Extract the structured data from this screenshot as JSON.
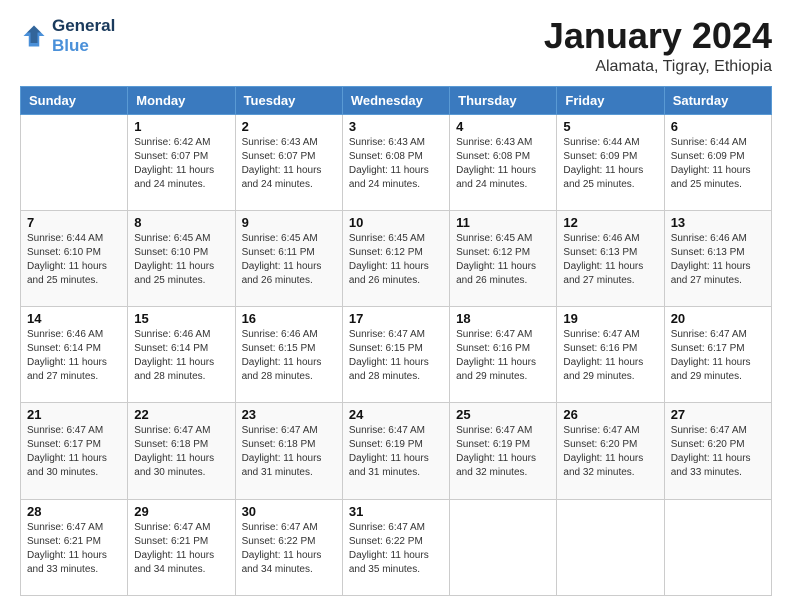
{
  "header": {
    "logo_line1": "General",
    "logo_line2": "Blue",
    "title": "January 2024",
    "subtitle": "Alamata, Tigray, Ethiopia"
  },
  "weekdays": [
    "Sunday",
    "Monday",
    "Tuesday",
    "Wednesday",
    "Thursday",
    "Friday",
    "Saturday"
  ],
  "weeks": [
    [
      {
        "day": "",
        "info": ""
      },
      {
        "day": "1",
        "info": "Sunrise: 6:42 AM\nSunset: 6:07 PM\nDaylight: 11 hours\nand 24 minutes."
      },
      {
        "day": "2",
        "info": "Sunrise: 6:43 AM\nSunset: 6:07 PM\nDaylight: 11 hours\nand 24 minutes."
      },
      {
        "day": "3",
        "info": "Sunrise: 6:43 AM\nSunset: 6:08 PM\nDaylight: 11 hours\nand 24 minutes."
      },
      {
        "day": "4",
        "info": "Sunrise: 6:43 AM\nSunset: 6:08 PM\nDaylight: 11 hours\nand 24 minutes."
      },
      {
        "day": "5",
        "info": "Sunrise: 6:44 AM\nSunset: 6:09 PM\nDaylight: 11 hours\nand 25 minutes."
      },
      {
        "day": "6",
        "info": "Sunrise: 6:44 AM\nSunset: 6:09 PM\nDaylight: 11 hours\nand 25 minutes."
      }
    ],
    [
      {
        "day": "7",
        "info": "Sunrise: 6:44 AM\nSunset: 6:10 PM\nDaylight: 11 hours\nand 25 minutes."
      },
      {
        "day": "8",
        "info": "Sunrise: 6:45 AM\nSunset: 6:10 PM\nDaylight: 11 hours\nand 25 minutes."
      },
      {
        "day": "9",
        "info": "Sunrise: 6:45 AM\nSunset: 6:11 PM\nDaylight: 11 hours\nand 26 minutes."
      },
      {
        "day": "10",
        "info": "Sunrise: 6:45 AM\nSunset: 6:12 PM\nDaylight: 11 hours\nand 26 minutes."
      },
      {
        "day": "11",
        "info": "Sunrise: 6:45 AM\nSunset: 6:12 PM\nDaylight: 11 hours\nand 26 minutes."
      },
      {
        "day": "12",
        "info": "Sunrise: 6:46 AM\nSunset: 6:13 PM\nDaylight: 11 hours\nand 27 minutes."
      },
      {
        "day": "13",
        "info": "Sunrise: 6:46 AM\nSunset: 6:13 PM\nDaylight: 11 hours\nand 27 minutes."
      }
    ],
    [
      {
        "day": "14",
        "info": "Sunrise: 6:46 AM\nSunset: 6:14 PM\nDaylight: 11 hours\nand 27 minutes."
      },
      {
        "day": "15",
        "info": "Sunrise: 6:46 AM\nSunset: 6:14 PM\nDaylight: 11 hours\nand 28 minutes."
      },
      {
        "day": "16",
        "info": "Sunrise: 6:46 AM\nSunset: 6:15 PM\nDaylight: 11 hours\nand 28 minutes."
      },
      {
        "day": "17",
        "info": "Sunrise: 6:47 AM\nSunset: 6:15 PM\nDaylight: 11 hours\nand 28 minutes."
      },
      {
        "day": "18",
        "info": "Sunrise: 6:47 AM\nSunset: 6:16 PM\nDaylight: 11 hours\nand 29 minutes."
      },
      {
        "day": "19",
        "info": "Sunrise: 6:47 AM\nSunset: 6:16 PM\nDaylight: 11 hours\nand 29 minutes."
      },
      {
        "day": "20",
        "info": "Sunrise: 6:47 AM\nSunset: 6:17 PM\nDaylight: 11 hours\nand 29 minutes."
      }
    ],
    [
      {
        "day": "21",
        "info": "Sunrise: 6:47 AM\nSunset: 6:17 PM\nDaylight: 11 hours\nand 30 minutes."
      },
      {
        "day": "22",
        "info": "Sunrise: 6:47 AM\nSunset: 6:18 PM\nDaylight: 11 hours\nand 30 minutes."
      },
      {
        "day": "23",
        "info": "Sunrise: 6:47 AM\nSunset: 6:18 PM\nDaylight: 11 hours\nand 31 minutes."
      },
      {
        "day": "24",
        "info": "Sunrise: 6:47 AM\nSunset: 6:19 PM\nDaylight: 11 hours\nand 31 minutes."
      },
      {
        "day": "25",
        "info": "Sunrise: 6:47 AM\nSunset: 6:19 PM\nDaylight: 11 hours\nand 32 minutes."
      },
      {
        "day": "26",
        "info": "Sunrise: 6:47 AM\nSunset: 6:20 PM\nDaylight: 11 hours\nand 32 minutes."
      },
      {
        "day": "27",
        "info": "Sunrise: 6:47 AM\nSunset: 6:20 PM\nDaylight: 11 hours\nand 33 minutes."
      }
    ],
    [
      {
        "day": "28",
        "info": "Sunrise: 6:47 AM\nSunset: 6:21 PM\nDaylight: 11 hours\nand 33 minutes."
      },
      {
        "day": "29",
        "info": "Sunrise: 6:47 AM\nSunset: 6:21 PM\nDaylight: 11 hours\nand 34 minutes."
      },
      {
        "day": "30",
        "info": "Sunrise: 6:47 AM\nSunset: 6:22 PM\nDaylight: 11 hours\nand 34 minutes."
      },
      {
        "day": "31",
        "info": "Sunrise: 6:47 AM\nSunset: 6:22 PM\nDaylight: 11 hours\nand 35 minutes."
      },
      {
        "day": "",
        "info": ""
      },
      {
        "day": "",
        "info": ""
      },
      {
        "day": "",
        "info": ""
      }
    ]
  ]
}
